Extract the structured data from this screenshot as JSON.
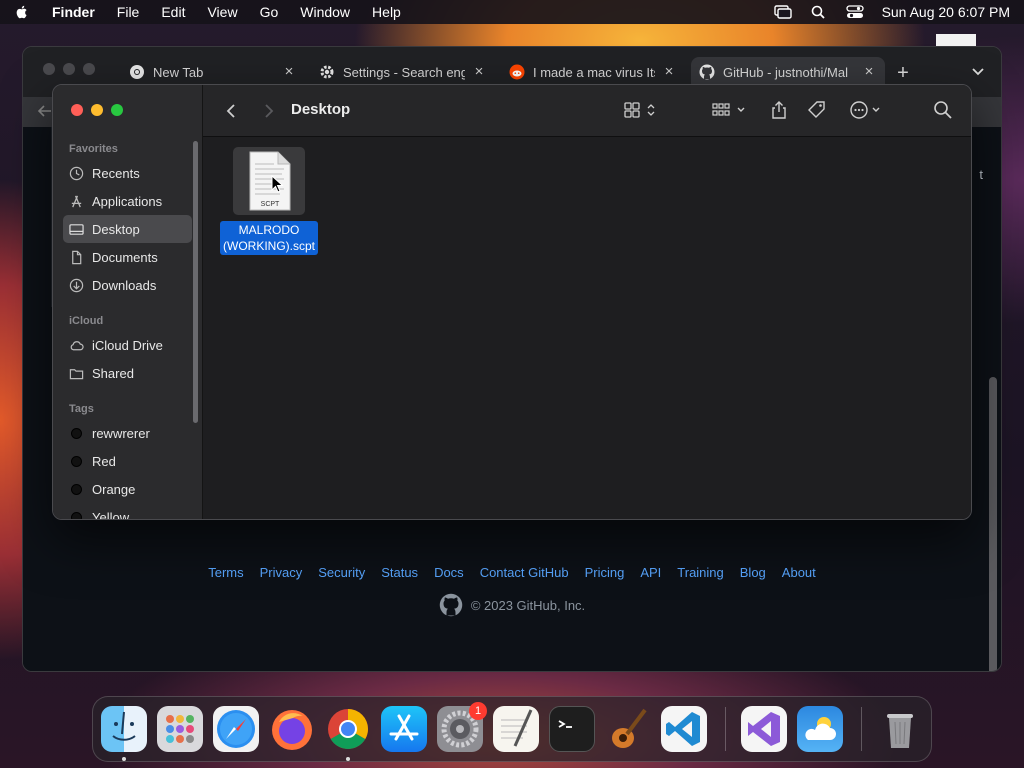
{
  "menubar": {
    "app_name": "Finder",
    "menus": [
      "File",
      "Edit",
      "View",
      "Go",
      "Window",
      "Help"
    ],
    "clock": "Sun Aug 20  6:07 PM"
  },
  "browser": {
    "tabs": [
      {
        "title": "New Tab",
        "icon": "chrome-icon"
      },
      {
        "title": "Settings - Search engi",
        "icon": "gear-icon"
      },
      {
        "title": "I made a mac virus Its",
        "icon": "reddit-icon"
      },
      {
        "title": "GitHub - justnothi/Mal",
        "icon": "github-icon",
        "active": true
      }
    ],
    "cut_text": "t",
    "footer_links": [
      "Terms",
      "Privacy",
      "Security",
      "Status",
      "Docs",
      "Contact GitHub",
      "Pricing",
      "API",
      "Training",
      "Blog",
      "About"
    ],
    "copyright": "© 2023 GitHub, Inc."
  },
  "finder": {
    "title": "Desktop",
    "sidebar": {
      "favorites_header": "Favorites",
      "favorites": [
        {
          "label": "Recents",
          "icon": "clock-icon"
        },
        {
          "label": "Applications",
          "icon": "applications-icon"
        },
        {
          "label": "Desktop",
          "icon": "desktop-icon",
          "selected": true
        },
        {
          "label": "Documents",
          "icon": "document-icon"
        },
        {
          "label": "Downloads",
          "icon": "download-icon"
        }
      ],
      "icloud_header": "iCloud",
      "icloud": [
        {
          "label": "iCloud Drive",
          "icon": "cloud-icon"
        },
        {
          "label": "Shared",
          "icon": "shared-folder-icon"
        }
      ],
      "tags_header": "Tags",
      "tags": [
        "rewwrerer",
        "Red",
        "Orange",
        "Yellow"
      ]
    },
    "file": {
      "name_line1": "MALRODO",
      "name_line2": "(WORKING).scpt",
      "icon_label": "SCPT"
    }
  },
  "dock": {
    "apps": [
      "Finder",
      "Launchpad",
      "Safari",
      "Firefox",
      "Google Chrome",
      "App Store",
      "System Settings",
      "TextEdit",
      "Terminal",
      "GarageBand",
      "Visual Studio Code",
      "Visual Studio",
      "Weather",
      "Trash"
    ],
    "settings_badge": "1"
  },
  "colors": {
    "selection_blue": "#0f62d6",
    "github_link": "#58a6ff",
    "traffic_red": "#ff5f57",
    "traffic_yellow": "#febc2e",
    "traffic_green": "#28c840"
  }
}
